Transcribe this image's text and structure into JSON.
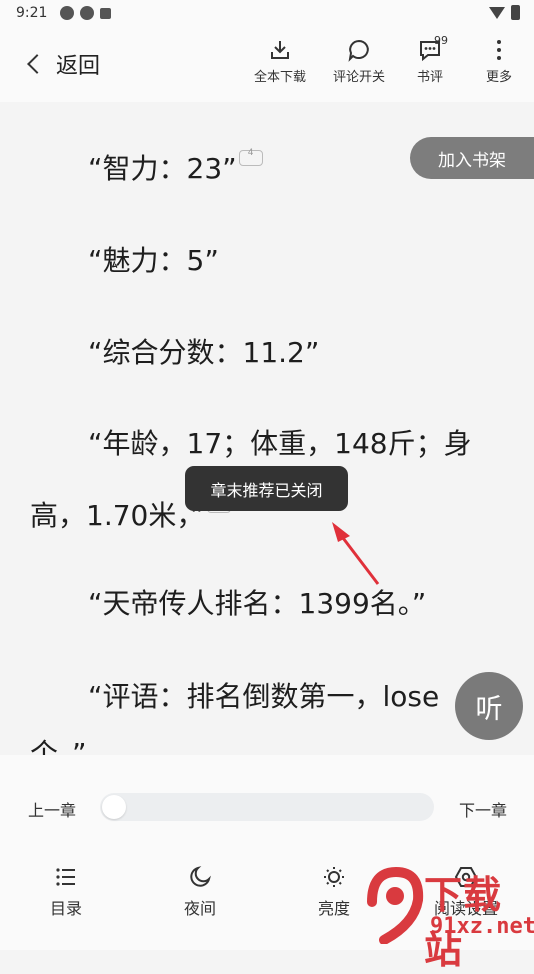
{
  "status_bar": {
    "time": "9:21"
  },
  "toolbar": {
    "back_label": "返回",
    "download_all": "全本下载",
    "comment_toggle": "评论开关",
    "book_review": "书评",
    "book_review_badge": "99",
    "more": "更多"
  },
  "reader": {
    "paragraphs": [
      "“智力：23”",
      "“魅力：5”",
      "“综合分数：11.2”",
      "“年龄，17；体重，148斤；身",
      "高，1.70米，”",
      "“天帝传人排名：1399名。”",
      "“评语：排名倒数第一，lose",
      "个。”"
    ],
    "comment_count": "4",
    "add_to_shelf": "加入书架",
    "listen": "听"
  },
  "toast": {
    "message": "章末推荐已关闭"
  },
  "chapter_nav": {
    "prev": "上一章",
    "next": "下一章",
    "progress": 0
  },
  "bottom_nav": {
    "toc": "目录",
    "night": "夜间",
    "brightness": "亮度",
    "reading_settings": "阅读设置"
  },
  "watermark": {
    "text": "下载站",
    "url": "91xz.net"
  },
  "colors": {
    "toast_bg": "#333333",
    "arrow": "#e0303a",
    "watermark": "#d93a3f"
  }
}
